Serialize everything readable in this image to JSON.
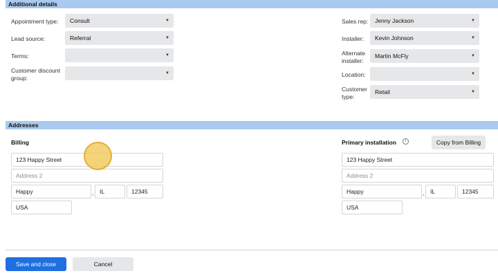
{
  "details": {
    "title": "Additional details",
    "appointment_type": {
      "label": "Appointment type:",
      "value": "Consult"
    },
    "lead_source": {
      "label": "Lead source:",
      "value": "Referral"
    },
    "terms": {
      "label": "Terms:",
      "value": ""
    },
    "customer_discount_group": {
      "label_line1": "Customer discount",
      "label_line2": "group:",
      "value": ""
    },
    "sales_rep": {
      "label": "Sales rep:",
      "value": "Jenny Jackson"
    },
    "installer": {
      "label": "Installer:",
      "value": "Kevin Johnson"
    },
    "alternate_installer": {
      "label_line1": "Alternate",
      "label_line2": "installer:",
      "value": "Martin McFly"
    },
    "location": {
      "label": "Location:",
      "value": ""
    },
    "customer_type": {
      "label_line1": "Customer",
      "label_line2": "type:",
      "value": "Retail"
    }
  },
  "addresses": {
    "title": "Addresses",
    "billing": {
      "heading": "Billing",
      "address1": "123 Happy Street",
      "address2_placeholder": "Address 2",
      "city": "Happy",
      "state": "IL",
      "zip": "12345",
      "country": "USA"
    },
    "primary_installation": {
      "heading": "Primary installation",
      "info_icon": "info-icon",
      "copy_button": "Copy from Billing",
      "address1": "123 Happy Street",
      "address2_placeholder": "Address 2",
      "city": "Happy",
      "state": "IL",
      "zip": "12345",
      "country": "USA"
    }
  },
  "footer": {
    "save_label": "Save and close",
    "cancel_label": "Cancel"
  },
  "colors": {
    "section_bar": "#a9c9ee",
    "primary_button": "#1e6fe0",
    "cursor_highlight": "#f0c448"
  }
}
